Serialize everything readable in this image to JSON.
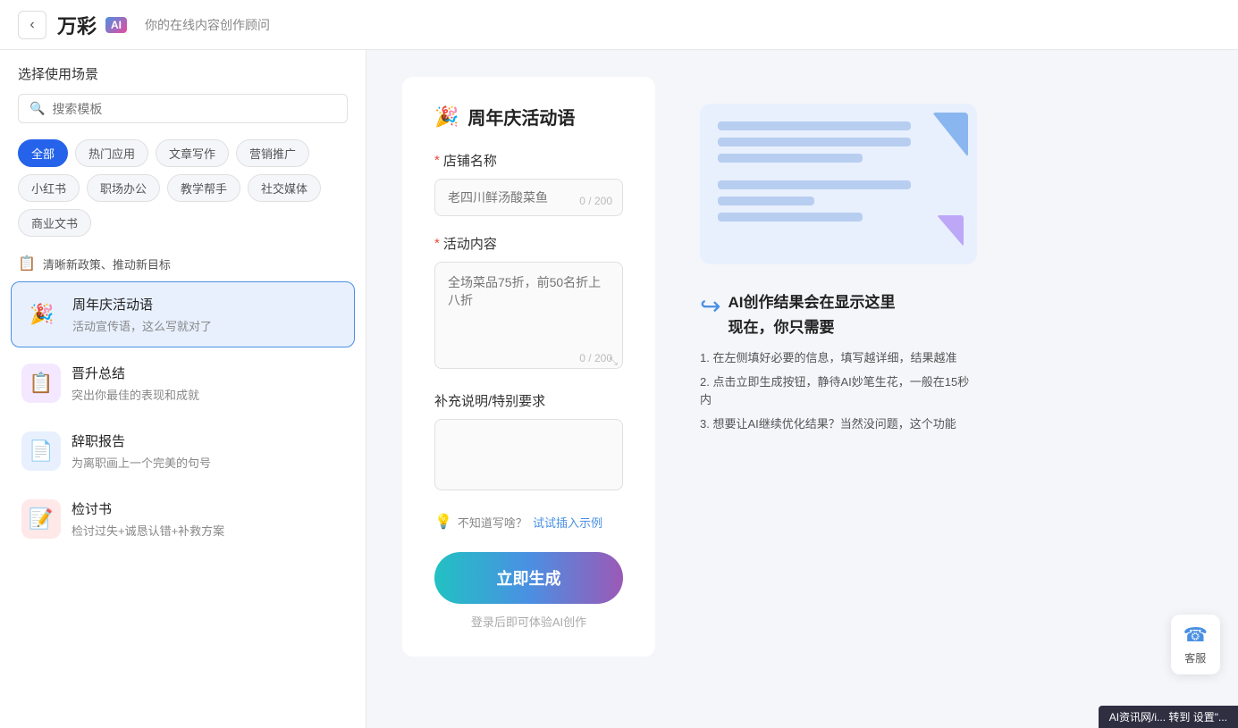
{
  "header": {
    "back_label": "‹",
    "logo_text": "万彩",
    "logo_ai": "AI",
    "subtitle": "你的在线内容创作顾问"
  },
  "sidebar": {
    "title": "选择使用场景",
    "search_placeholder": "搜索模板",
    "tags": [
      {
        "label": "全部",
        "active": true
      },
      {
        "label": "热门应用",
        "active": false
      },
      {
        "label": "文章写作",
        "active": false
      },
      {
        "label": "营销推广",
        "active": false
      },
      {
        "label": "小红书",
        "active": false
      },
      {
        "label": "职场办公",
        "active": false
      },
      {
        "label": "教学帮手",
        "active": false
      },
      {
        "label": "社交媒体",
        "active": false
      },
      {
        "label": "商业文书",
        "active": false
      }
    ],
    "section_hint": "清晰新政策、推动新目标",
    "templates": [
      {
        "id": "anniversary",
        "icon": "🎉",
        "icon_class": "blue-light",
        "name": "周年庆活动语",
        "desc": "活动宣传语，这么写就对了",
        "active": true
      },
      {
        "id": "promotion",
        "icon": "📋",
        "icon_class": "purple-light",
        "name": "晋升总结",
        "desc": "突出你最佳的表现和成就",
        "active": false
      },
      {
        "id": "resignation",
        "icon": "📄",
        "icon_class": "blue-light",
        "name": "辞职报告",
        "desc": "为离职画上一个完美的句号",
        "active": false
      },
      {
        "id": "review",
        "icon": "📝",
        "icon_class": "red-light",
        "name": "检讨书",
        "desc": "检讨过失+诚恳认错+补救方案",
        "active": false
      }
    ]
  },
  "form": {
    "title_icon": "🎉",
    "title": "周年庆活动语",
    "fields": {
      "store_name": {
        "label": "店铺名称",
        "placeholder": "老四川鲜汤酸菜鱼",
        "char_count": "0 / 200",
        "required": true
      },
      "activity_content": {
        "label": "活动内容",
        "placeholder": "全场菜品75折，前50名折上八折",
        "char_count": "0 / 200",
        "required": true
      },
      "supplement": {
        "label": "补充说明/特别要求",
        "placeholder": "",
        "required": false
      }
    },
    "hint_text": "不知道写啥？试试插入示例",
    "hint_icon": "💡",
    "generate_btn": "立即生成",
    "login_hint": "登录后即可体验AI创作"
  },
  "ai_tip": {
    "title": "AI创作结果会在显示这里\n现在，你只需要",
    "title_line1": "AI创作结果会在显示这里",
    "title_line2": "现在，你只需要",
    "steps": [
      "1. 在左侧填好必要的信息，填写越详细，结果越准",
      "2. 点击立即生成按钮，静待AI妙笔生花，一般在15秒内",
      "3. 想要让AI继续优化结果？当然没问题，这个功能"
    ]
  },
  "customer_service": {
    "icon": "☎",
    "label": "客服"
  },
  "bottom_bar": {
    "text": "AI资讯网/i... 转到 设置\"..."
  }
}
